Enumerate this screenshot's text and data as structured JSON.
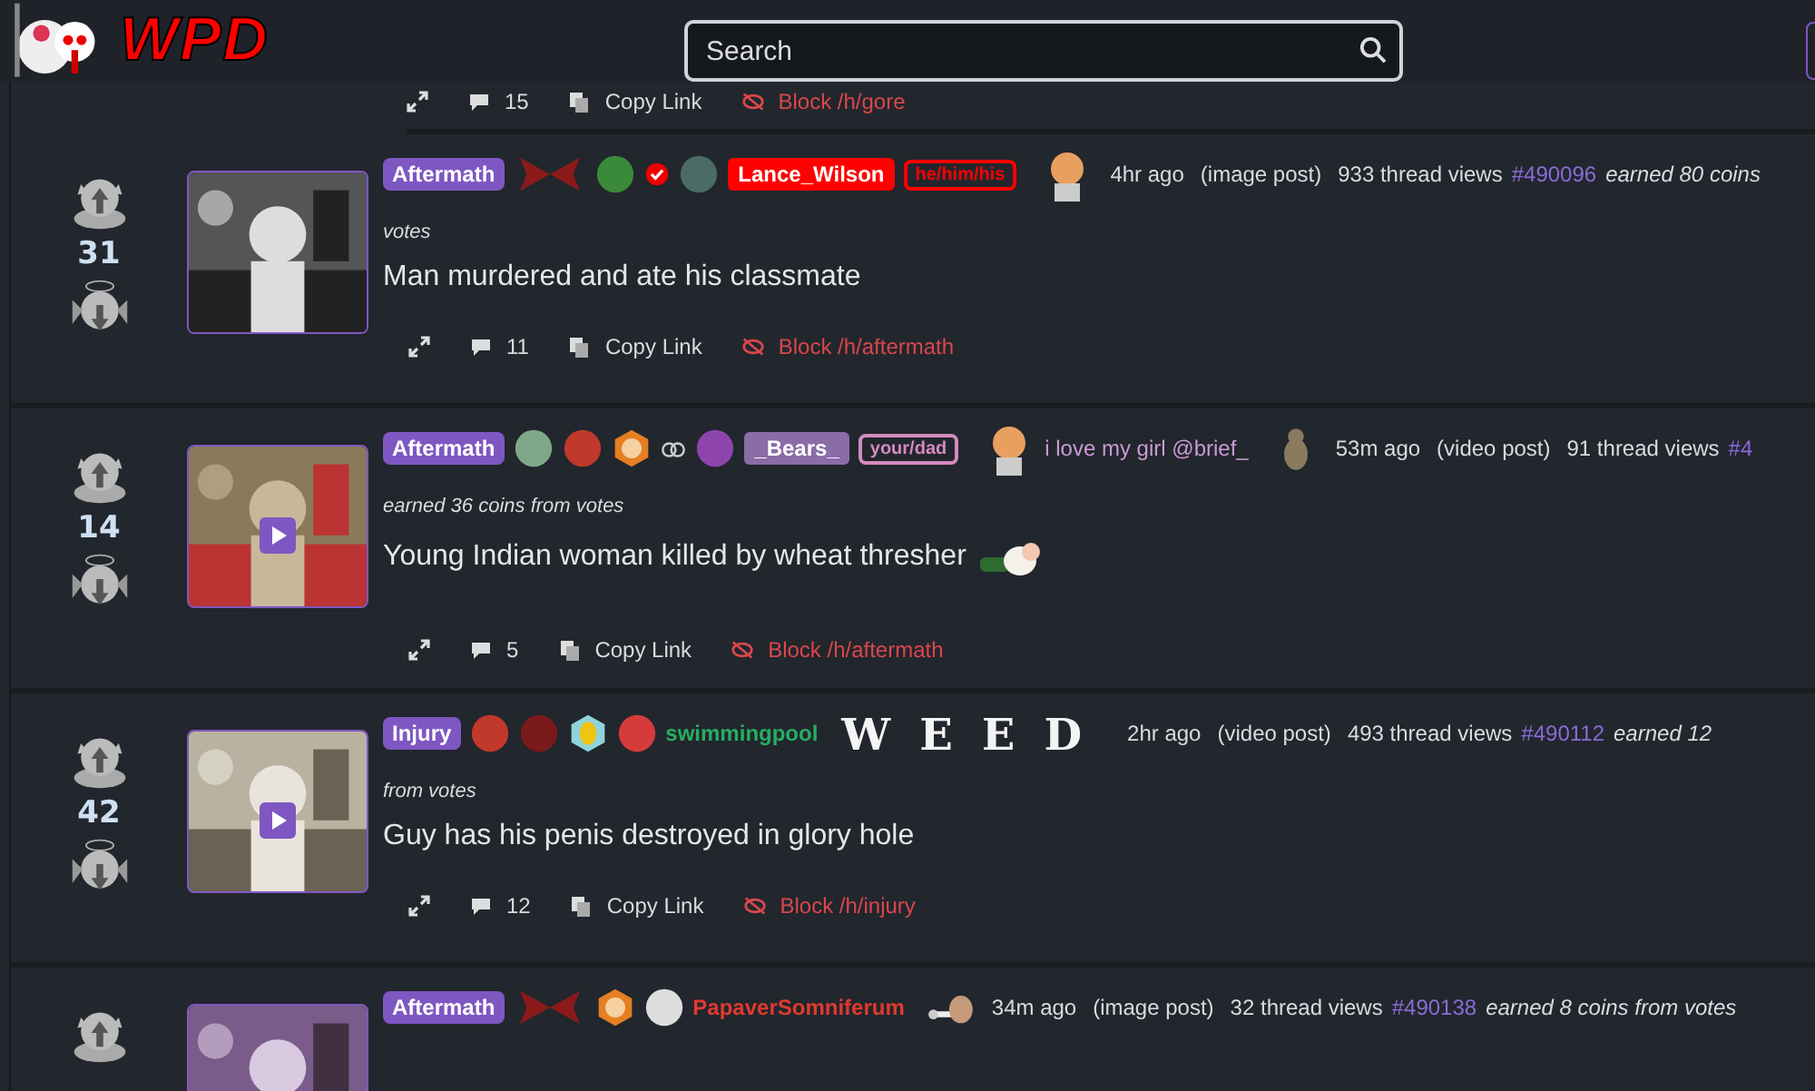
{
  "header": {
    "logo_text": "WPD",
    "search": {
      "placeholder": "Search"
    }
  },
  "top_partial": {
    "comments": "15",
    "copy": "Copy Link",
    "block": "Block /h/gore"
  },
  "posts": [
    {
      "votes": "31",
      "video": false,
      "tag": "Aftermath",
      "badges": [
        {
          "kind": "wings"
        },
        {
          "kind": "avatar",
          "color": "#3a8a3a"
        },
        {
          "kind": "verified"
        },
        {
          "kind": "avatar",
          "color": "#4a6b66"
        }
      ],
      "user": {
        "name": "Lance_Wilson",
        "kind": "boxed",
        "color": "#ff0000"
      },
      "pronoun": {
        "text": "he/him/his",
        "color": "#ff0000"
      },
      "trail": [
        {
          "kind": "avatar"
        }
      ],
      "meta": [
        "4hr ago",
        "(image post)",
        "933 thread views"
      ],
      "post_id": "#490096",
      "earned": "earned 80 coins",
      "line2": "votes",
      "title": "Man murdered and ate his classmate",
      "comments": "11",
      "copy": "Copy Link",
      "block": "Block /h/aftermath"
    },
    {
      "votes": "14",
      "video": true,
      "tag": "Aftermath",
      "badges": [
        {
          "kind": "avatar",
          "color": "#7fa88a"
        },
        {
          "kind": "avatar",
          "color": "#c0392b"
        },
        {
          "kind": "hex"
        },
        {
          "kind": "rings"
        },
        {
          "kind": "avatar",
          "color": "#8e44ad"
        }
      ],
      "user": {
        "name": "_Bears_",
        "kind": "boxed",
        "color": "#8a6ca6"
      },
      "pronoun": {
        "text": "your/dad",
        "color": "#d48ac0"
      },
      "trail": [
        {
          "kind": "avatar"
        },
        {
          "kind": "status",
          "text": "i love my girl @brief_"
        },
        {
          "kind": "pet"
        }
      ],
      "meta": [
        "53m ago",
        "(video post)",
        "91 thread views"
      ],
      "post_id": "#4",
      "line2": "earned 36 coins from votes",
      "title": "Young Indian woman killed by wheat thresher",
      "title_icon": true,
      "comments": "5",
      "copy": "Copy Link",
      "block": "Block /h/aftermath"
    },
    {
      "votes": "42",
      "video": true,
      "tag": "Injury",
      "badges": [
        {
          "kind": "avatar",
          "color": "#c0392b"
        },
        {
          "kind": "avatar",
          "color": "#7b1a1a"
        },
        {
          "kind": "coin"
        },
        {
          "kind": "avatar",
          "color": "#d63b3b"
        }
      ],
      "user": {
        "name": "swimmingpool",
        "kind": "plain",
        "color": "#27ae60"
      },
      "flair": "WEED",
      "meta": [
        "2hr ago",
        "(video post)",
        "493 thread views"
      ],
      "post_id": "#490112",
      "earned": "earned 12",
      "line2": "from votes",
      "title": "Guy has his penis destroyed in glory hole",
      "comments": "12",
      "copy": "Copy Link",
      "block": "Block /h/injury"
    },
    {
      "video": false,
      "tag": "Aftermath",
      "badges": [
        {
          "kind": "wings"
        },
        {
          "kind": "hex"
        },
        {
          "kind": "avatar",
          "color": "#dddddd"
        }
      ],
      "user": {
        "name": "PapaverSomniferum",
        "kind": "plain",
        "color": "#e03a2f"
      },
      "trail": [
        {
          "kind": "hand"
        }
      ],
      "meta": [
        "34m ago",
        "(image post)",
        "32 thread views"
      ],
      "post_id": "#490138",
      "earned": "earned 8 coins from votes"
    }
  ]
}
